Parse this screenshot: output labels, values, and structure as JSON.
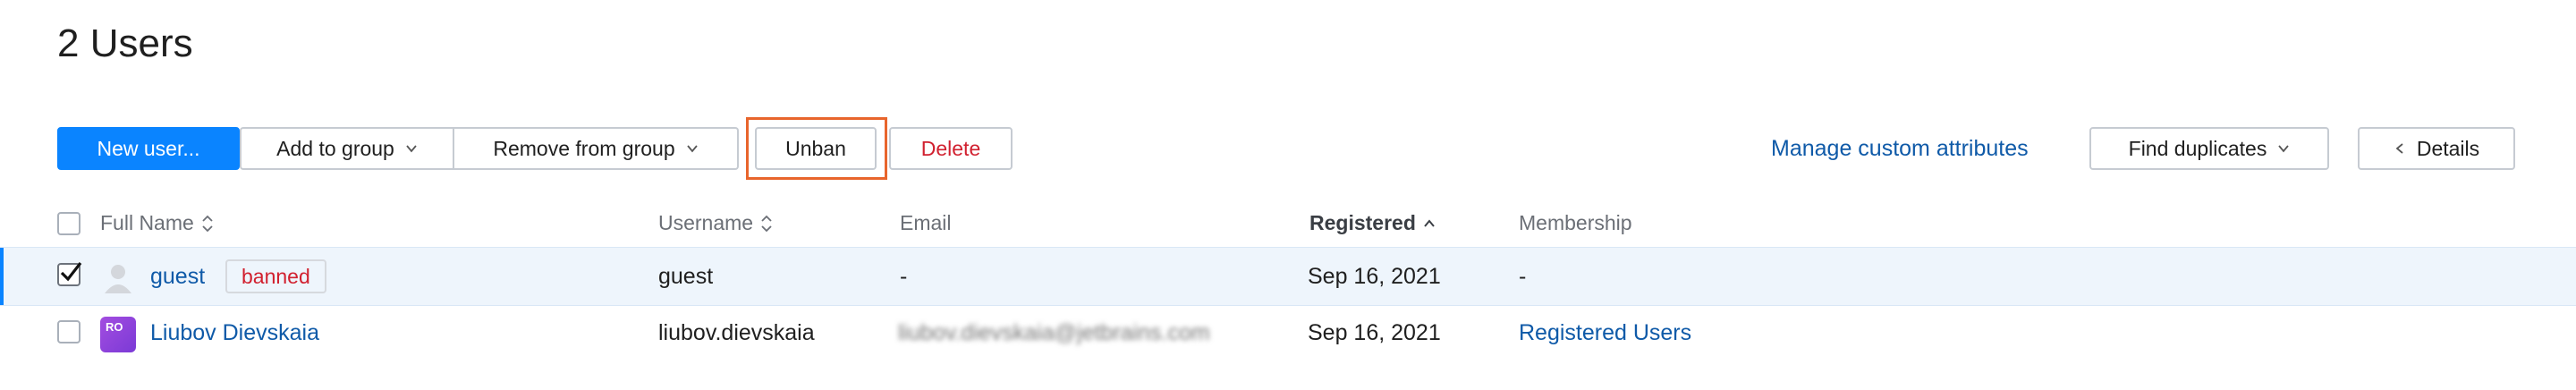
{
  "page": {
    "title": "2 Users"
  },
  "toolbar": {
    "new_user": "New user...",
    "add_to_group": "Add to group",
    "remove_from_group": "Remove from group",
    "unban": "Unban",
    "delete": "Delete",
    "manage_attributes": "Manage custom attributes",
    "find_duplicates": "Find duplicates",
    "details": "Details"
  },
  "table": {
    "headers": {
      "full_name": "Full Name",
      "username": "Username",
      "email": "Email",
      "registered": "Registered",
      "membership": "Membership"
    },
    "rows": [
      {
        "selected": true,
        "full_name": "guest",
        "badge": "banned",
        "username": "guest",
        "email": "-",
        "registered": "Sep 16, 2021",
        "membership": "-"
      },
      {
        "selected": false,
        "avatar_initials": "RO",
        "full_name": "Liubov Dievskaia",
        "username": "liubov.dievskaia",
        "email": "liubov.dievskaia@jetbrains.com",
        "registered": "Sep 16, 2021",
        "membership": "Registered Users"
      }
    ]
  },
  "colors": {
    "primary": "#0a84ff",
    "link": "#0f5aa8",
    "danger": "#d1202f",
    "highlight": "#e8652c",
    "selected_row": "#eef5fc"
  }
}
